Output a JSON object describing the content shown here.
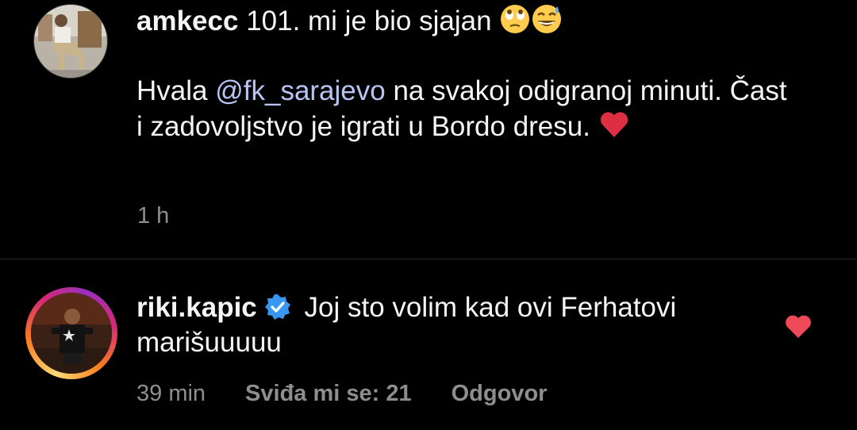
{
  "comments": [
    {
      "username": "amkecc",
      "text_line1": "101. mi je bio sjajan",
      "text_para2_before": "Hvala ",
      "mention": "@fk_sarajevo",
      "text_para2_after": " na svakoj odigranoj minuti. Čast i zadovoljstvo je igrati u Bordo dresu.",
      "time": "1 h",
      "emoji1": "face-with-rolling-eyes-emoji",
      "emoji2": "grinning-face-with-sweat-emoji",
      "emoji3": "red-heart-emoji"
    },
    {
      "username": "riki.kapic",
      "verified": true,
      "text": "Joj sto volim kad ovi Ferhatovi marišuuuuu",
      "time": "39 min",
      "likes_label": "Sviđa mi se: 21",
      "reply_label": "Odgovor",
      "like_icon": "heart-icon"
    }
  ],
  "colors": {
    "background": "#000000",
    "text": "#f5f5f5",
    "secondary": "#8e8e8e",
    "mention": "#b8c5f2",
    "verified": "#3897f0",
    "heart": "#ed4956"
  }
}
